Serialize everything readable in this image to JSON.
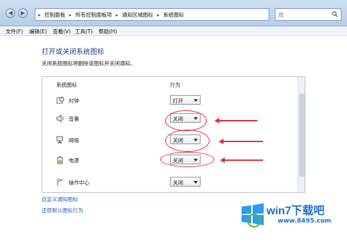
{
  "address_bar": {
    "crumbs": [
      "控制面板",
      "所有控制面板项",
      "通知区域图标",
      "系统图标"
    ],
    "search_placeholder": "搜"
  },
  "menu": {
    "items": [
      "文件(F)",
      "编辑(E)",
      "查看(V)",
      "工具(T)",
      "帮助(H)"
    ]
  },
  "main": {
    "title": "打开或关闭系统图标",
    "description": "关闭系统图标将删除该图标并关闭通知。",
    "headers": {
      "icon": "系统图标",
      "behavior": "行为"
    },
    "rows": [
      {
        "label": "时钟",
        "value": "打开",
        "icon": "clock-icon"
      },
      {
        "label": "音量",
        "value": "关闭",
        "icon": "speaker-icon"
      },
      {
        "label": "网络",
        "value": "关闭",
        "icon": "network-icon"
      },
      {
        "label": "电源",
        "value": "关闭",
        "icon": "power-icon"
      },
      {
        "label": "操作中心",
        "value": "关闭",
        "icon": "flag-icon"
      }
    ],
    "links": [
      "自定义通知图标",
      "还原默认图标行为"
    ]
  },
  "watermark": {
    "brand": "win7下载吧",
    "url": "www.8495.com"
  },
  "colors": {
    "annotation": "#e0303a",
    "title": "#1e3f8f",
    "link": "#1f5fb8"
  }
}
